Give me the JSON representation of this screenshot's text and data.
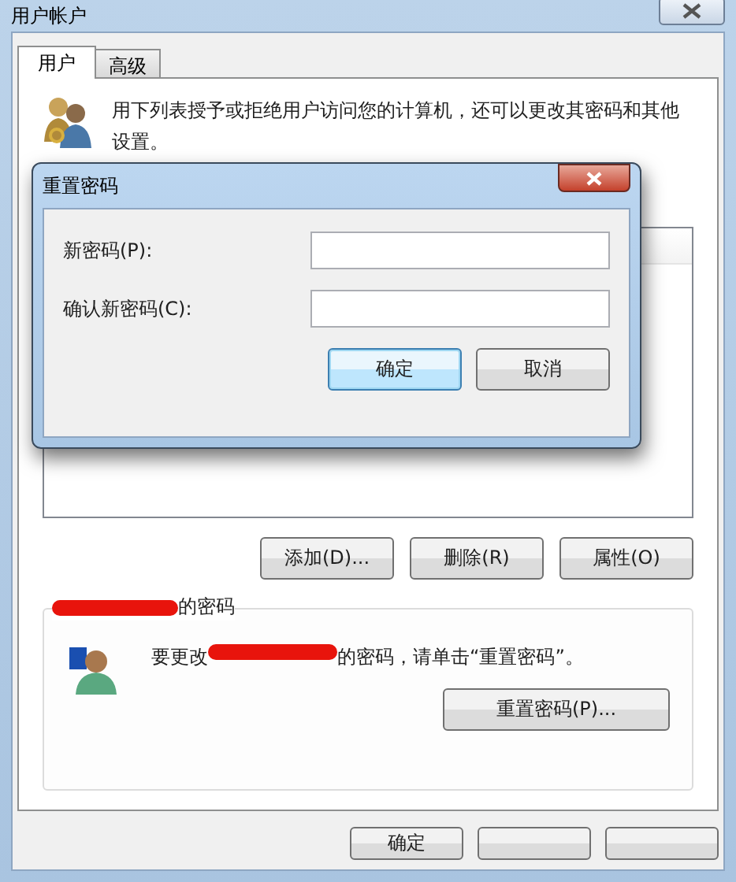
{
  "window": {
    "title": "用户帐户"
  },
  "tabs": [
    {
      "label": "用户",
      "selected": true
    },
    {
      "label": "高级",
      "selected": false
    }
  ],
  "intro": "用下列表授予或拒绝用户访问您的计算机，还可以更改其密码和其他设置。",
  "user_buttons": [
    "添加(D)...",
    "删除(R)",
    "属性(O)"
  ],
  "password_group": {
    "title": "的密码",
    "message_before": "要更改",
    "message_after": "的密码，请单击“重置密码”。",
    "button": "重置密码(P)..."
  },
  "footer_buttons": [
    "确定"
  ],
  "dialog": {
    "title": "重置密码",
    "fields": [
      {
        "label": "新密码(P):"
      },
      {
        "label": "确认新密码(C):"
      }
    ],
    "buttons": [
      {
        "label": "确定",
        "default": true
      },
      {
        "label": "取消",
        "default": false
      }
    ]
  }
}
